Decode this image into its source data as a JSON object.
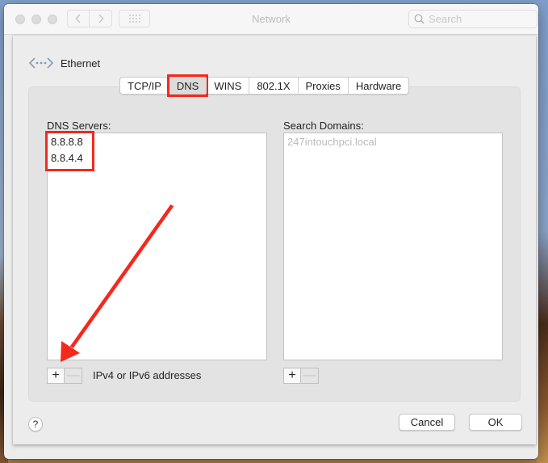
{
  "window": {
    "title": "Network",
    "search_placeholder": "Search",
    "nav": {
      "back_icon": "chevron-left-icon",
      "forward_icon": "chevron-right-icon",
      "grid_icon": "show-all-grid-icon"
    }
  },
  "sheet": {
    "interface_name": "Ethernet",
    "interface_icon": "ethernet-icon",
    "tabs": [
      {
        "label": "TCP/IP",
        "active": false
      },
      {
        "label": "DNS",
        "active": true
      },
      {
        "label": "WINS",
        "active": false
      },
      {
        "label": "802.1X",
        "active": false
      },
      {
        "label": "Proxies",
        "active": false
      },
      {
        "label": "Hardware",
        "active": false
      }
    ],
    "dns_servers": {
      "label": "DNS Servers:",
      "entries": [
        "8.8.8.8",
        "8.8.4.4"
      ],
      "hint": "IPv4 or IPv6 addresses",
      "add_label": "+",
      "remove_label": "—"
    },
    "search_domains": {
      "label": "Search Domains:",
      "placeholder_entries": [
        "247intouchpci.local"
      ],
      "add_label": "+",
      "remove_label": "—"
    },
    "help_label": "?",
    "cancel_label": "Cancel",
    "ok_label": "OK"
  },
  "annotations": {
    "highlight_color": "#f5281c",
    "highlighted": [
      "DNS tab",
      "DNS server entries"
    ],
    "arrow_target": "add DNS server button"
  }
}
